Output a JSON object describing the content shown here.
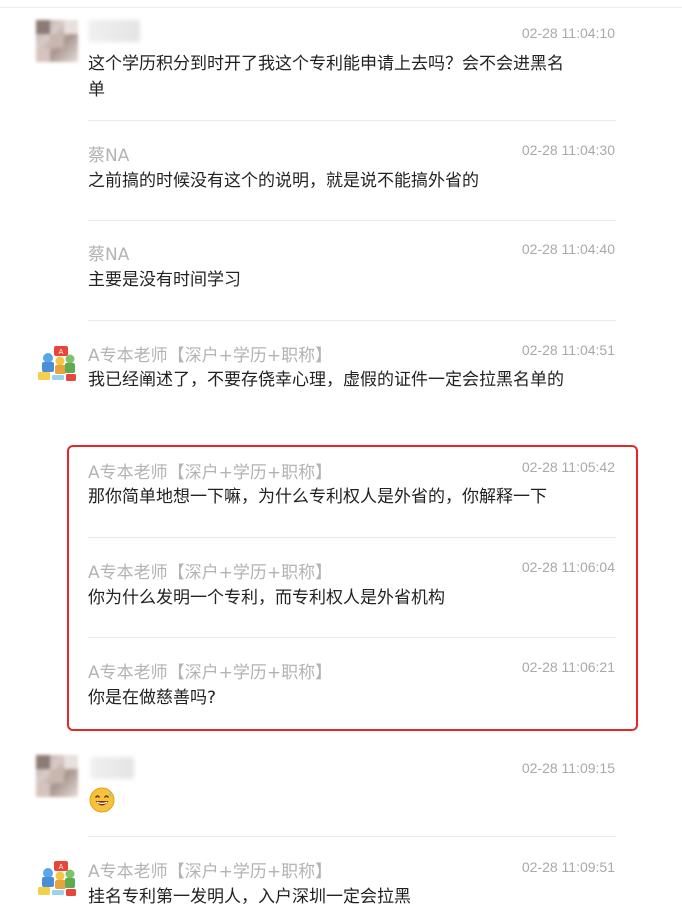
{
  "messages": [
    {
      "sender": "",
      "time": "02-28 11:04:10",
      "text": "这个学历积分到时开了我这个专利能申请上去吗？会不会进黑名单"
    },
    {
      "sender": "蔡NA",
      "time": "02-28 11:04:30",
      "text": "之前搞的时候没有这个的说明，就是说不能搞外省的"
    },
    {
      "sender": "蔡NA",
      "time": "02-28 11:04:40",
      "text": "主要是没有时间学习"
    },
    {
      "sender": "A专本老师【深户+学历+职称】",
      "time": "02-28 11:04:51",
      "text": "我已经阐述了，不要存侥幸心理，虚假的证件一定会拉黑名单的"
    },
    {
      "sender": "A专本老师【深户+学历+职称】",
      "time": "02-28 11:05:42",
      "text": "那你简单地想一下嘛，为什么专利权人是外省的，你解释一下"
    },
    {
      "sender": "A专本老师【深户+学历+职称】",
      "time": "02-28 11:06:04",
      "text": "你为什么发明一个专利，而专利权人是外省机构"
    },
    {
      "sender": "A专本老师【深户+学历+职称】",
      "time": "02-28 11:06:21",
      "text": "你是在做慈善吗?"
    },
    {
      "sender": "",
      "time": "02-28 11:09:15",
      "text": "",
      "emoji": "grinning-sweat-emoji"
    },
    {
      "sender": "A专本老师【深户+学历+职称】",
      "time": "02-28 11:09:51",
      "text": "挂名专利第一发明人，入户深圳一定会拉黑"
    }
  ],
  "colors": {
    "highlight_border": "#e8262a",
    "sender_gray": "#b3b3b3",
    "time_gray": "#a9a9a9",
    "text": "#222222"
  },
  "icons": {
    "teacher_avatar": "cartoon-group-avatar-icon",
    "blurred_avatar": "pixelated-avatar"
  }
}
